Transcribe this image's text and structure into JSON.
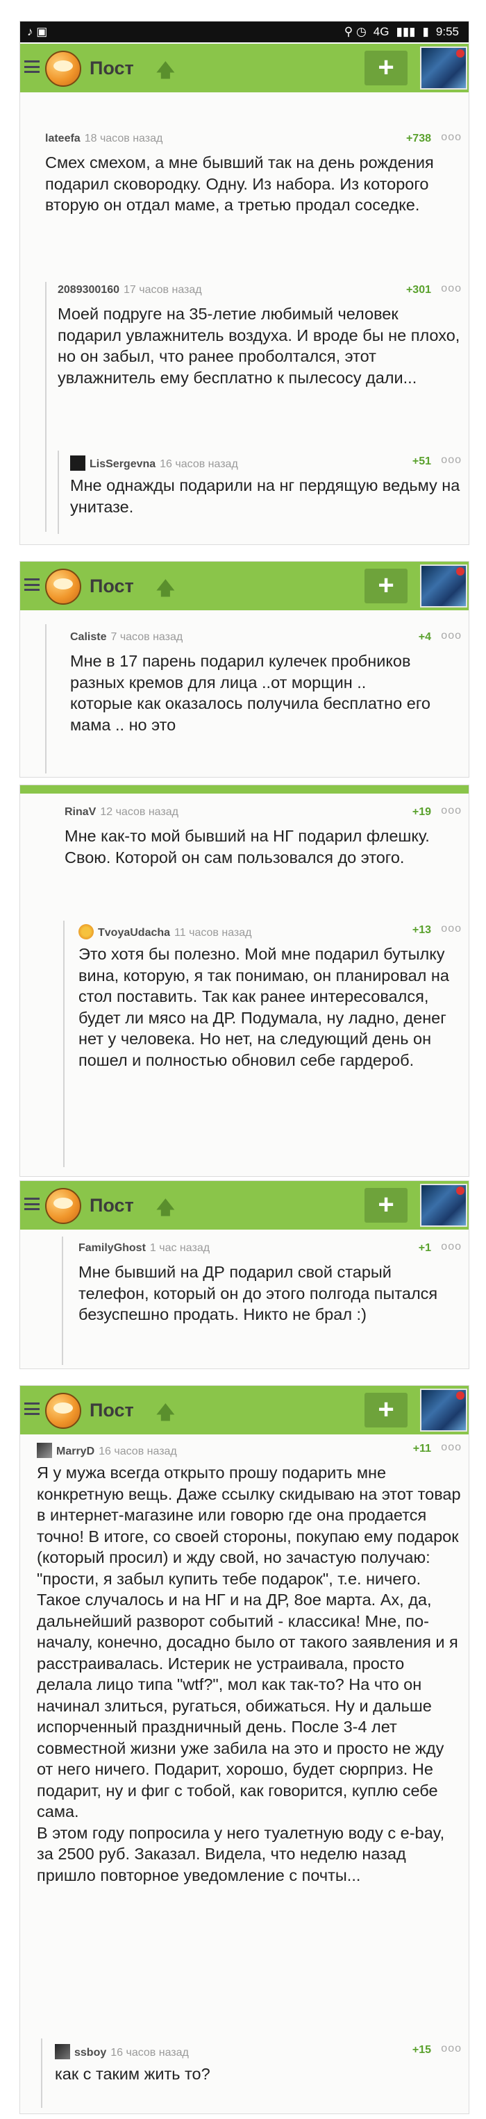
{
  "status": {
    "time": "9:55",
    "network": "4G",
    "left_icons": "♪ ▣",
    "right_icons": "⚲ ◷"
  },
  "topbar": {
    "title": "Пост",
    "up_arrow": "🡅",
    "plus": "+"
  },
  "icons": {
    "menu": "hamburger-menu-icon",
    "logo": "pikabu-logo-icon",
    "avatar": "user-avatar",
    "dots": "ooo"
  },
  "comments": {
    "c1": {
      "author": "lateefa",
      "time": "18 часов назад",
      "score": "+738",
      "text": "Смех смехом, а мне бывший так на день рождения подарил сковородку. Одну. Из набора. Из которого вторую он отдал маме, а третью продал соседке."
    },
    "c2": {
      "author": "2089300160",
      "time": "17 часов назад",
      "score": "+301",
      "text": "Моей подруге на 35-летие любимый человек подарил увлажнитель воздуха. И вроде бы не плохо, но он забыл, что ранее проболтался, этот увлажнитель ему бесплатно к пылесосу дали..."
    },
    "c3": {
      "author": "LisSergevna",
      "time": "16 часов назад",
      "score": "+51",
      "text": "Мне однажды подарили на нг пердящую ведьму на унитазе."
    },
    "c4": {
      "author": "Caliste",
      "time": "7 часов назад",
      "score": "+4",
      "text": "Мне в 17 парень подарил кулечек пробников разных кремов для лица ..от морщин .. которые как оказалось получила бесплатно его мама .. но это"
    },
    "c5": {
      "author": "RinaV",
      "time": "12 часов назад",
      "score": "+19",
      "text": "Мне как-то мой бывший на НГ подарил флешку. Свою. Которой он сам пользовался до этого."
    },
    "c6": {
      "author": "TvoyaUdacha",
      "time": "11 часов назад",
      "score": "+13",
      "text": "Это хотя бы полезно. Мой мне подарил бутылку вина, которую, я так понимаю, он планировал на стол поставить. Так как ранее интересовался, будет ли мясо на ДР. Подумала, ну ладно, денег нет у человека. Но нет, на следующий день он пошел и полностью обновил себе гардероб."
    },
    "c7": {
      "author": "FamilyGhost",
      "time": "1 час назад",
      "score": "+1",
      "text": "Мне бывший на ДР подарил свой старый телефон, который он до этого полгода пытался безуспешно продать. Никто не брал :)"
    },
    "c8": {
      "author": "MarryD",
      "time": "16 часов назад",
      "score": "+11",
      "text": "Я у мужа всегда открыто прошу подарить мне конкретную вещь. Даже ссылку скидываю на этот товар в интернет-магазине или говорю где она продается точно! В итоге, со своей стороны, покупаю ему подарок (который просил) и жду свой, но зачастую получаю: \"прости, я забыл купить тебе подарок\", т.е. ничего. Такое случалось и на НГ и на ДР, 8ое марта. Ах, да, дальнейший разворот событий - классика! Мне, по-началу, конечно, досадно было от такого заявления и я расстраивалась. Истерик не устраивала, просто делала лицо типа \"wtf?\", мол как так-то? На что он начинал злиться, ругаться, обижаться. Ну и дальше испорченный праздничный день. После 3-4 лет совместной жизни уже забила на это и просто не жду от него ничего. Подарит, хорошо, будет сюрприз. Не подарит, ну и фиг с тобой, как говорится, куплю себе сама.\nВ этом году попросила у него туалетную воду с e-bay, за 2500 руб. Заказал. Видела, что неделю назад пришло повторное уведомление с почты..."
    },
    "c9": {
      "author": "ssboy",
      "time": "16 часов назад",
      "score": "+15",
      "text": "как с таким жить то?"
    }
  }
}
